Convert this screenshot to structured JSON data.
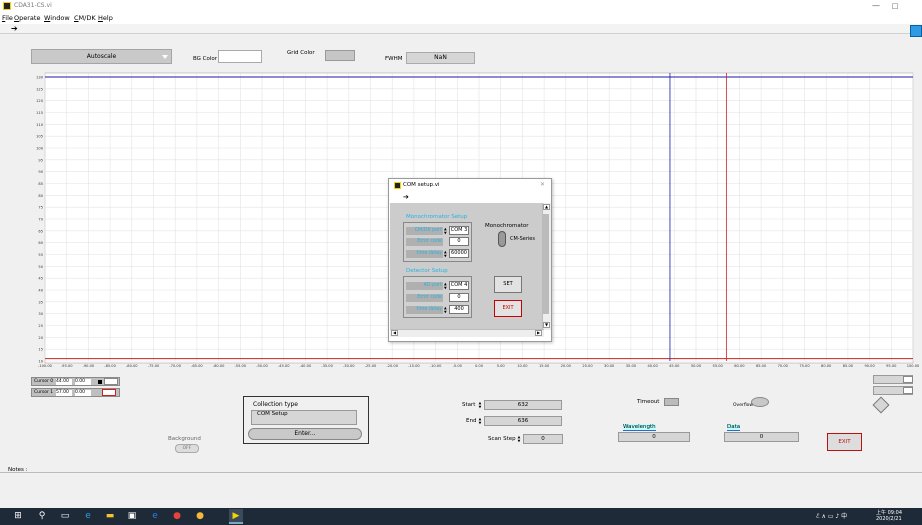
{
  "window": {
    "title": "CDA31-CS.vi",
    "min": "—",
    "max": "□"
  },
  "menu": [
    "File",
    "Operate",
    "Window",
    "CM/DK",
    "Help"
  ],
  "toolbar": {
    "run_icon": "run-arrow-icon"
  },
  "controls": {
    "autoscale": "Autoscale",
    "bg_color_label": "BG Color",
    "grid_color_label": "Grid Color",
    "fwhm_label": "FWHM",
    "fwhm_value": "NaN"
  },
  "chart_data": {
    "type": "line",
    "y_ticks": [
      "130",
      "125",
      "120",
      "115",
      "110",
      "105",
      "100",
      "95",
      "90",
      "85",
      "80",
      "75",
      "70",
      "65",
      "60",
      "55",
      "50",
      "45",
      "40",
      "35",
      "30",
      "25",
      "20",
      "15",
      "10"
    ],
    "x_ticks": [
      "-100.00",
      "-95.00",
      "-90.00",
      "-85.00",
      "-80.00",
      "-75.00",
      "-70.00",
      "-65.00",
      "-60.00",
      "-55.00",
      "-50.00",
      "-45.00",
      "-40.00",
      "-35.00",
      "-30.00",
      "-25.00",
      "-20.00",
      "-15.00",
      "-10.00",
      "-5.00",
      "0.00",
      "5.00",
      "10.00",
      "15.00",
      "20.00",
      "25.00",
      "30.00",
      "35.00",
      "40.00",
      "45.00",
      "50.00",
      "55.00",
      "60.00",
      "65.00",
      "70.00",
      "75.00",
      "80.00",
      "85.00",
      "90.00",
      "95.00",
      "100.00"
    ],
    "xlim": [
      -100,
      100
    ],
    "ylim": [
      10,
      130
    ],
    "grid": true,
    "cursors": [
      {
        "name": "Cursor 0",
        "x": 44.0,
        "color": "#1a1aaa"
      },
      {
        "name": "Cursor 1",
        "x": 57.0,
        "color": "#cc2222"
      }
    ],
    "series": [
      {
        "values": [
          {
            "x": -100,
            "y": 130
          },
          {
            "x": 100,
            "y": 130
          }
        ],
        "color": "#1a1aaa"
      },
      {
        "values": [
          {
            "x": -100,
            "y": 11
          },
          {
            "x": 100,
            "y": 11
          }
        ],
        "color": "#cc2222"
      }
    ]
  },
  "cursors": [
    {
      "name": "Cursor 0",
      "x": "44.00",
      "y": "0.00"
    },
    {
      "name": "Cursor 1",
      "x": "57.00",
      "y": "0.00"
    }
  ],
  "bottom": {
    "background_label": "Background",
    "background_toggle": "OFF",
    "collection_label": "Collection type",
    "collection_value": "COM Setup",
    "enter_label": "Enter...",
    "start_label": "Start",
    "start_value": "632",
    "end_label": "End",
    "end_value": "636",
    "scan_step_label": "Scan Step",
    "scan_step_value": "0",
    "timeout_label": "Timeout",
    "overflow_label": "Overflow",
    "wavelength_label": "Wavelength",
    "wavelength_value": "0",
    "data_label": "Data",
    "data_value": "0",
    "exit_label": "EXIT",
    "notes_label": "Notes :"
  },
  "dialog": {
    "title": "COM setup.vi",
    "close": "✕",
    "mono_section": "Monochromator Setup",
    "mono_fields": [
      {
        "label": "CM/DK port",
        "value": "COM 3"
      },
      {
        "label": "Error code",
        "value": "0"
      },
      {
        "label": "time delay",
        "value": "60000"
      }
    ],
    "mono_title": "Monochromator",
    "mono_option": "CM-Series",
    "detector_section": "Detector Setup",
    "detector_fields": [
      {
        "label": "AD port",
        "value": "COM 4"
      },
      {
        "label": "Error code",
        "value": "0"
      },
      {
        "label": "time delay",
        "value": "400"
      }
    ],
    "set_label": "SET",
    "exit_label": "EXIT"
  },
  "taskbar": {
    "time": "上午 09:04",
    "date": "2020/2/21"
  }
}
